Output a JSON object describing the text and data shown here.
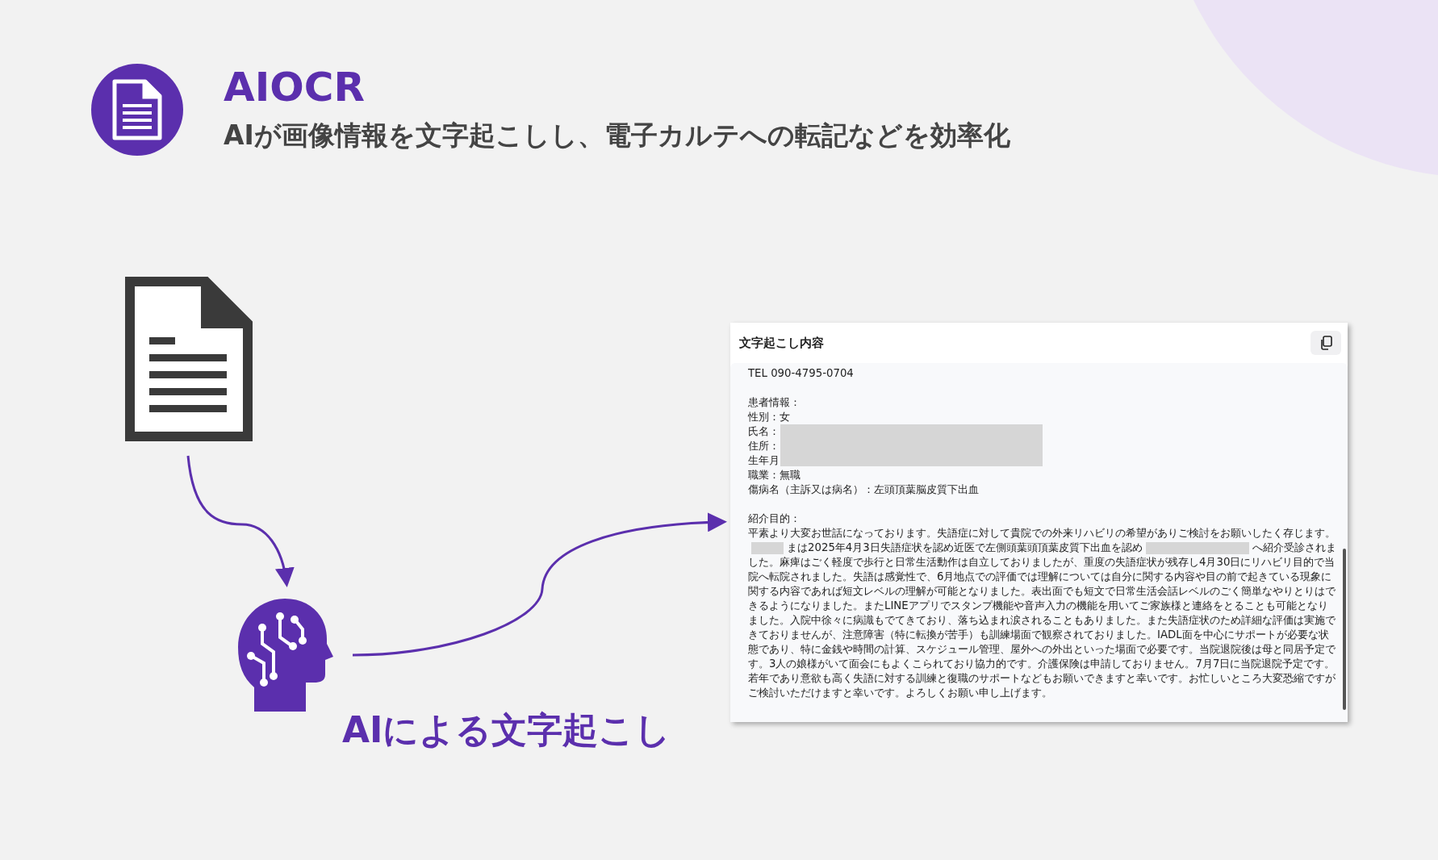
{
  "header": {
    "title": "AIOCR",
    "subtitle": "AIが画像情報を文字起こしし、電子カルテへの転記などを効率化"
  },
  "flow": {
    "label": "AIによる文字起こし"
  },
  "panel": {
    "title": "文字起こし内容",
    "blocks": [
      {
        "kind": "line",
        "text": "TEL 090-4795-0704"
      },
      {
        "kind": "blank"
      },
      {
        "kind": "line",
        "text": "患者情報："
      },
      {
        "kind": "line",
        "text": "性別：女"
      },
      {
        "kind": "redacted_lines",
        "lines": [
          "氏名：",
          "住所：",
          "生年月"
        ]
      },
      {
        "kind": "line",
        "text": "職業：無職"
      },
      {
        "kind": "line",
        "text": "傷病名（主訴又は病名）：左頭頂葉脳皮質下出血"
      },
      {
        "kind": "blank"
      },
      {
        "kind": "line",
        "text": "紹介目的："
      },
      {
        "kind": "paragraph",
        "segments": [
          {
            "kind": "text",
            "text": "平素より大変お世話になっております。失語症に対して貴院での外来リハビリの希望がありご検討をお願いしたく存じます。"
          },
          {
            "kind": "redaction_short"
          },
          {
            "kind": "text",
            "text": "まは2025年4月3日失語症状を認め近医で左側頭葉頭頂葉皮質下出血を認め"
          },
          {
            "kind": "redaction_long"
          },
          {
            "kind": "text",
            "text": "へ紹介受診されました。麻痺はごく軽度で歩行と日常生活動作は自立しておりましたが、重度の失語症状が残存し4月30日にリハビリ目的で当院へ転院されました。失語は感覚性で、6月地点での評価では理解については自分に関する内容や目の前で起きている現象に関する内容であれば短文レベルの理解が可能となりました。表出面でも短文で日常生活会話レベルのごく簡単なやりとりはできるようになりました。またLINEアプリでスタンプ機能や音声入力の機能を用いてご家族様と連絡をとることも可能となりました。入院中徐々に病識もでてきており、落ち込まれ涙されることもありました。また失語症状のため詳細な評価は実施できておりませんが、注意障害（特に転換が苦手）も訓練場面で観察されておりました。IADL面を中心にサポートが必要な状態であり、特に金銭や時間の計算、スケジュール管理、屋外への外出といった場面で必要です。当院退院後は母と同居予定です。3人の娘様がいて面会にもよくこられており協力的です。介護保険は申請しておりません。7月7日に当院退院予定です。若年であり意欲も高く失語に対する訓練と復職のサポートなどもお願いできますと幸いです。お忙しいところ大変恐縮ですがご検討いただけますと幸いです。よろしくお願い申し上げます。"
          }
        ]
      }
    ]
  }
}
